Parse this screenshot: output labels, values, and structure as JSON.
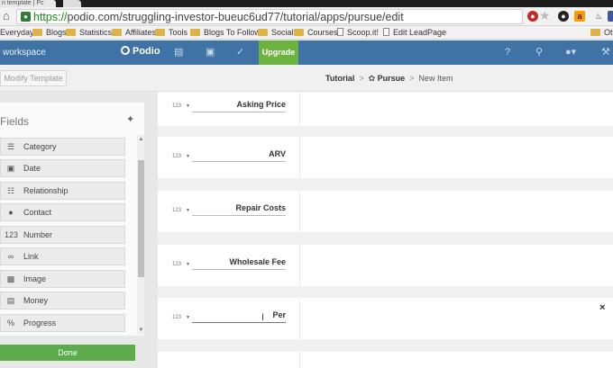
{
  "browser": {
    "tab_title": "n template | Pc",
    "url_scheme": "https://",
    "url_rest": "podio.com/struggling-investor-bueuc6ud77/tutorial/apps/pursue/edit",
    "bookmarks": [
      {
        "label": "Everyday",
        "type": "folder"
      },
      {
        "label": "Blogs",
        "type": "folder"
      },
      {
        "label": "Statistics",
        "type": "folder"
      },
      {
        "label": "Affiliates",
        "type": "folder"
      },
      {
        "label": "Tools",
        "type": "folder"
      },
      {
        "label": "Blogs To Follow",
        "type": "folder"
      },
      {
        "label": "Social",
        "type": "folder"
      },
      {
        "label": "Courses",
        "type": "folder"
      },
      {
        "label": "Scoop.it!",
        "type": "page"
      },
      {
        "label": "Edit LeadPage",
        "type": "page"
      },
      {
        "label": "Ot",
        "type": "folder"
      }
    ]
  },
  "podio": {
    "workspace": "workspace",
    "logo": "Podio",
    "upgrade": "Upgrade",
    "brand_color": "#3f73a5",
    "upgrade_color": "#6cb33e"
  },
  "subheader": {
    "modify_template": "Modify Template",
    "breadcrumb": [
      "Tutorial",
      "Pursue",
      "New Item"
    ]
  },
  "fields_panel": {
    "title": "Fields",
    "items": [
      {
        "label": "Category",
        "icon": "category-icon"
      },
      {
        "label": "Date",
        "icon": "calendar-icon"
      },
      {
        "label": "Relationship",
        "icon": "relationship-icon"
      },
      {
        "label": "Contact",
        "icon": "contact-icon"
      },
      {
        "label": "Number",
        "icon": "number-icon"
      },
      {
        "label": "Link",
        "icon": "link-icon"
      },
      {
        "label": "Image",
        "icon": "image-icon"
      },
      {
        "label": "Money",
        "icon": "money-icon"
      },
      {
        "label": "Progress",
        "icon": "progress-icon"
      }
    ],
    "done": "Done"
  },
  "template_fields": [
    {
      "label": "Asking Price"
    },
    {
      "label": "ARV"
    },
    {
      "label": "Repair Costs"
    },
    {
      "label": "Wholesale Fee"
    },
    {
      "label": "Per"
    }
  ]
}
